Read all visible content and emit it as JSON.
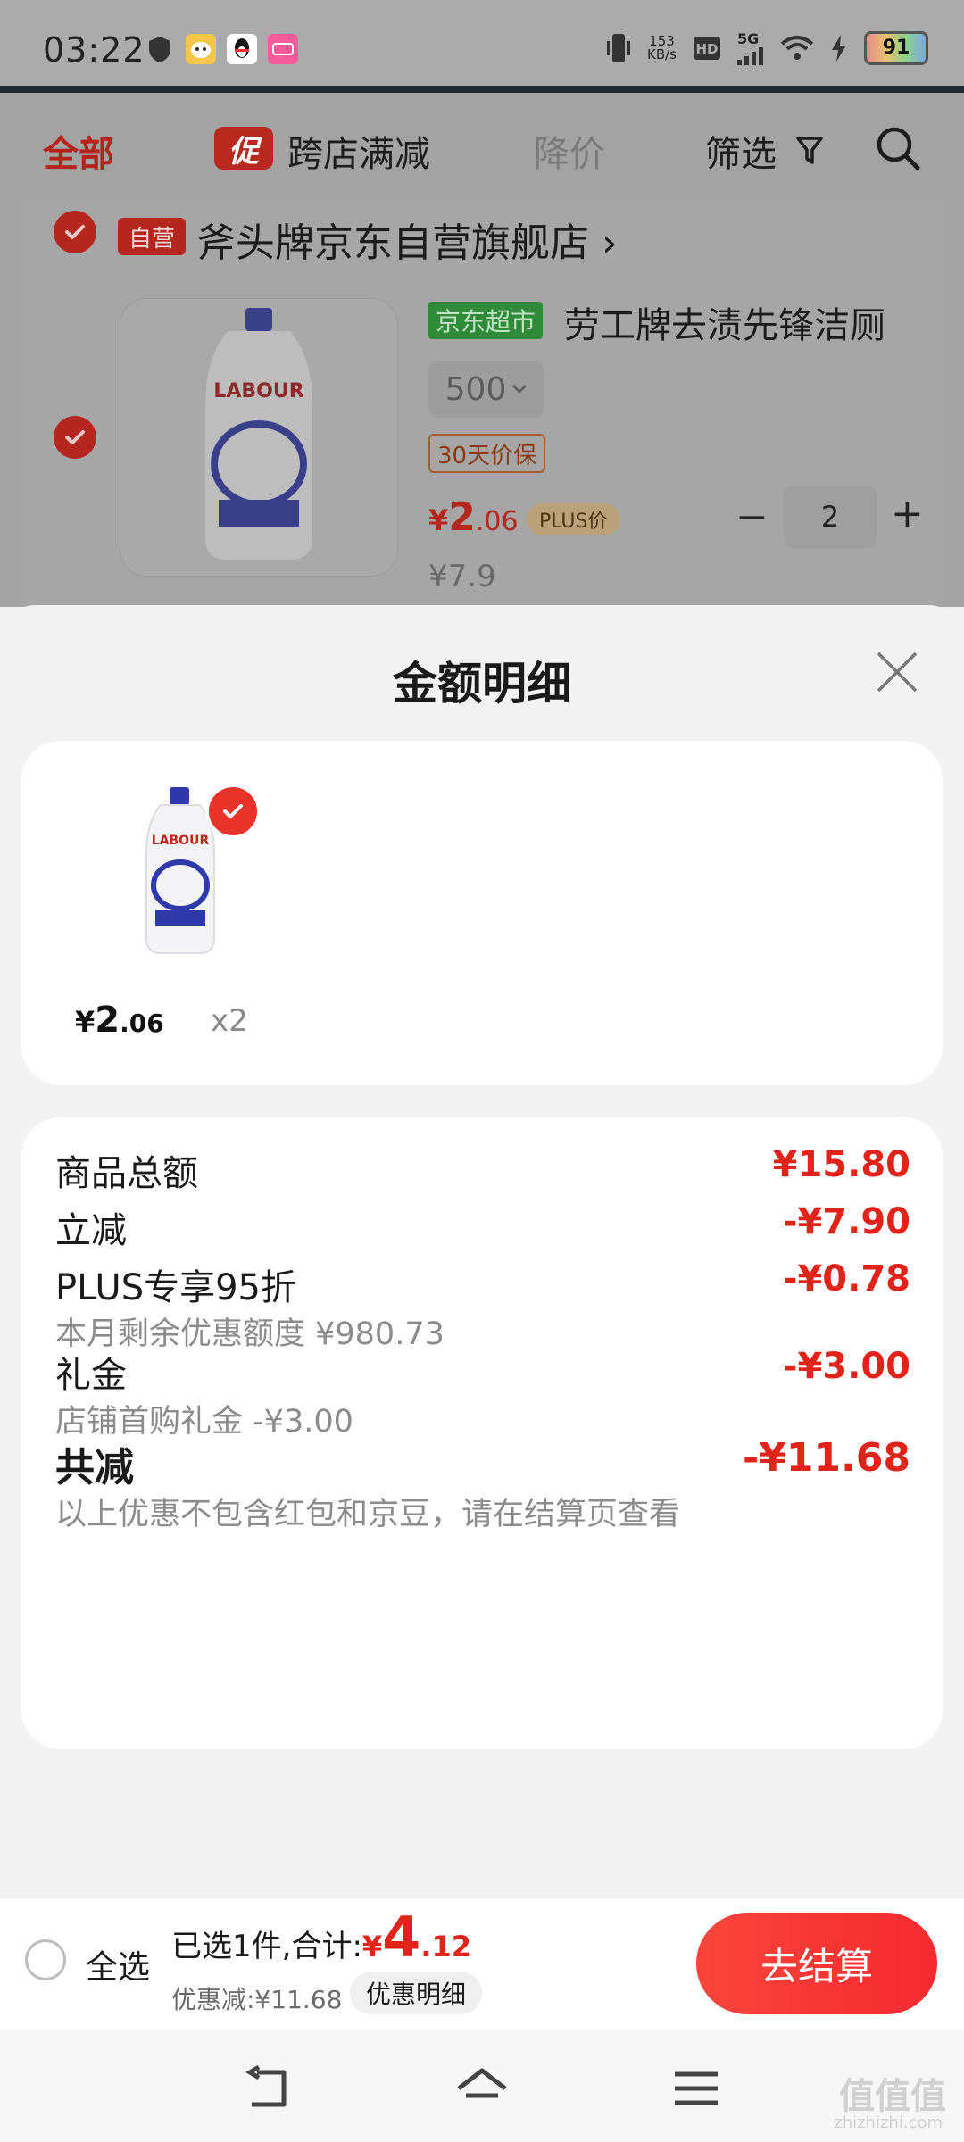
{
  "status_bar": {
    "time": "03:22",
    "net_speed_value": "153",
    "net_speed_unit": "KB/s",
    "network": "5G",
    "battery": "91"
  },
  "filter_bar": {
    "all": "全部",
    "promo_tag": "促",
    "cross_store": "跨店满减",
    "price_drop": "降价",
    "filter": "筛选"
  },
  "store": {
    "self_tag": "自营",
    "name": "斧头牌京东自营旗舰店 ›",
    "item": {
      "channel_tag": "京东超市",
      "title": "劳工牌去渍先锋洁厕",
      "spec": "500",
      "guarantee": "30天价保",
      "price_currency": "¥",
      "price_int": "2",
      "price_dec": ".06",
      "plus_tag": "PLUS价",
      "qty_minus": "−",
      "quantity": "2",
      "qty_plus": "+",
      "original_price": "¥7.9"
    }
  },
  "sheet": {
    "title": "金额明细",
    "product": {
      "price_currency": "¥",
      "price_int": "2",
      "price_dec": ".06",
      "qty": "x2"
    },
    "rows": [
      {
        "label": "商品总额",
        "value": "¥15.80",
        "sub": ""
      },
      {
        "label": "立减",
        "value": "-¥7.90",
        "sub": ""
      },
      {
        "label": "PLUS专享95折",
        "value": "-¥0.78",
        "sub": "本月剩余优惠额度 ¥980.73"
      },
      {
        "label": "礼金",
        "value": "-¥3.00",
        "sub": "店铺首购礼金 -¥3.00"
      }
    ],
    "total": {
      "label": "共减",
      "value": "-¥11.68",
      "note": "以上优惠不包含红包和京豆，请在结算页查看"
    }
  },
  "checkout": {
    "select_all": "全选",
    "selected_text": "已选1件,合计:",
    "total_currency": "¥",
    "total_int": "4",
    "total_dec": ".12",
    "discount_text": "优惠减:¥11.68",
    "discount_detail": "优惠明细",
    "checkout_button": "去结算"
  },
  "nav": {
    "watermark": "值值值",
    "watermark_sub": "zhizhizhi.com"
  },
  "colors": {
    "accent_red": "#e2231a",
    "checkout_red": "#f52a2f",
    "jd_green": "#2f8b3a"
  }
}
